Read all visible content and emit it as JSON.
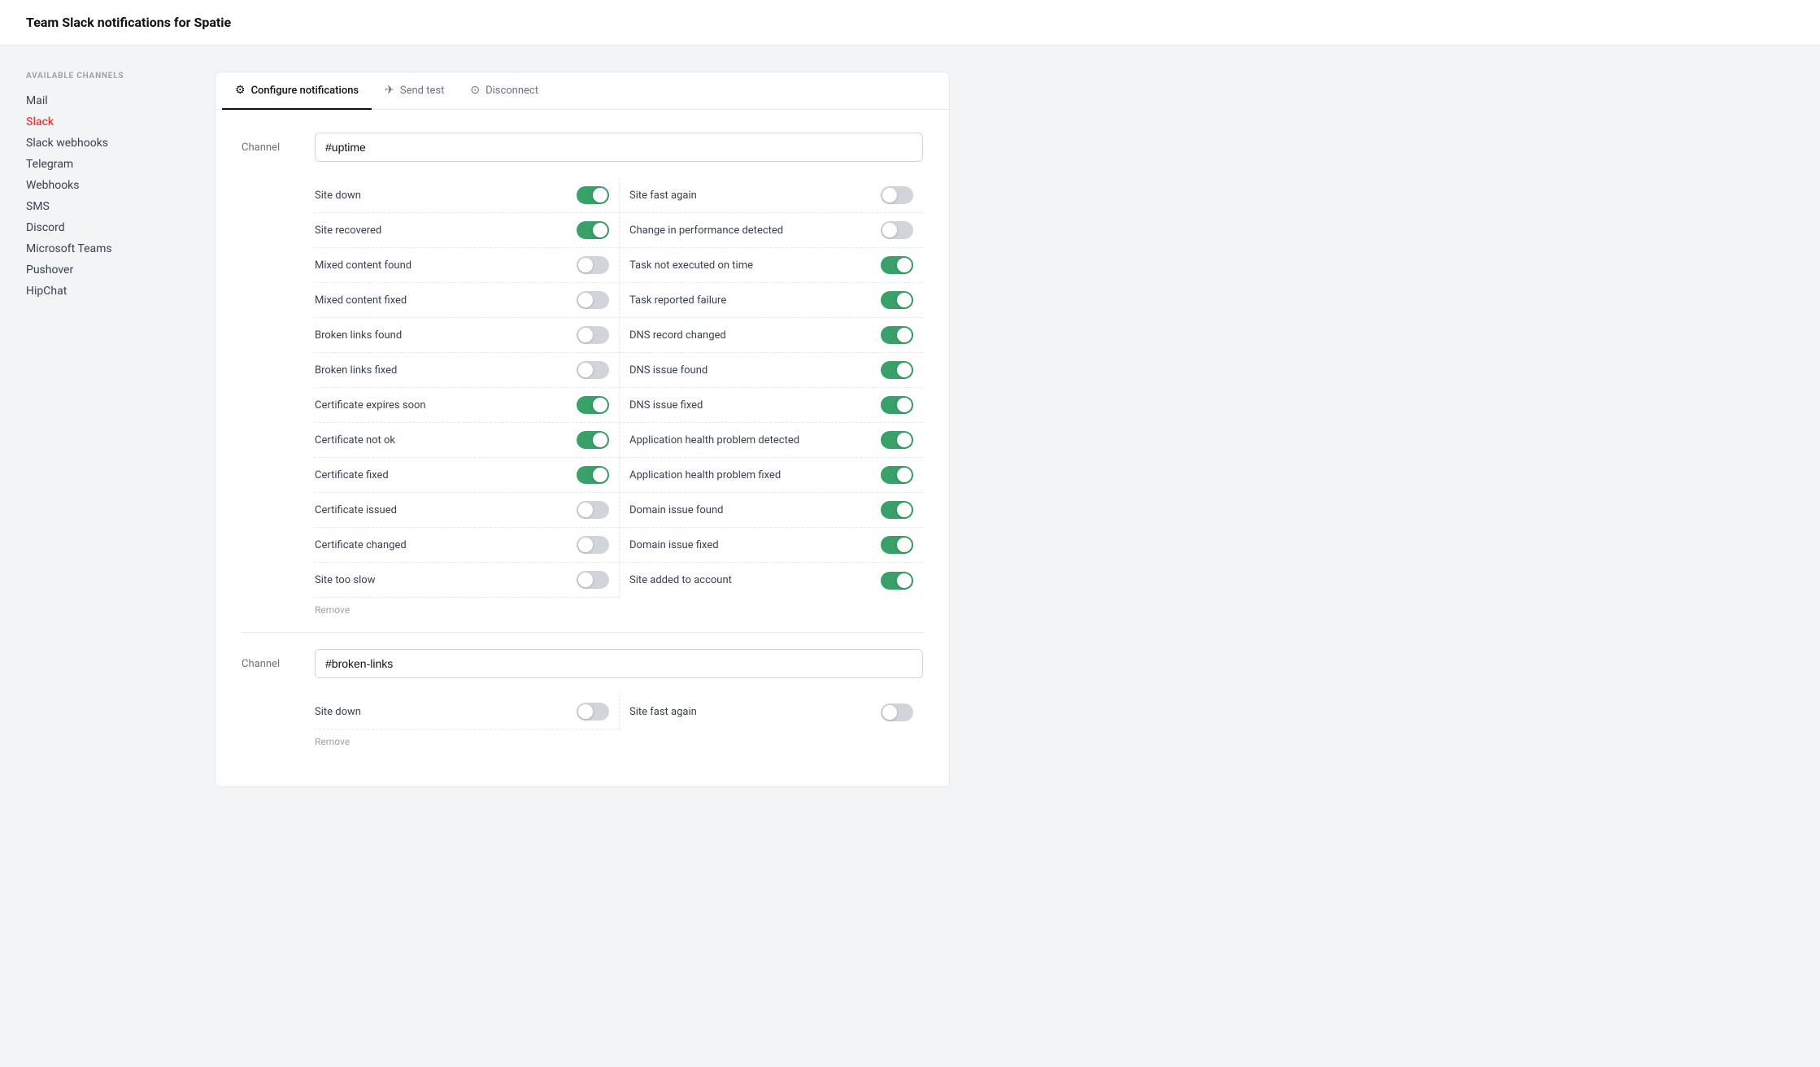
{
  "page": {
    "title": "Team Slack notifications for Spatie"
  },
  "sidebar": {
    "section_label": "Available Channels",
    "items": [
      {
        "id": "mail",
        "label": "Mail",
        "active": false
      },
      {
        "id": "slack",
        "label": "Slack",
        "active": true
      },
      {
        "id": "slack-webhooks",
        "label": "Slack webhooks",
        "active": false
      },
      {
        "id": "telegram",
        "label": "Telegram",
        "active": false
      },
      {
        "id": "webhooks",
        "label": "Webhooks",
        "active": false
      },
      {
        "id": "sms",
        "label": "SMS",
        "active": false
      },
      {
        "id": "discord",
        "label": "Discord",
        "active": false
      },
      {
        "id": "microsoft-teams",
        "label": "Microsoft Teams",
        "active": false
      },
      {
        "id": "pushover",
        "label": "Pushover",
        "active": false
      },
      {
        "id": "hipchat",
        "label": "HipChat",
        "active": false
      }
    ]
  },
  "tabs": [
    {
      "id": "configure",
      "label": "Configure notifications",
      "icon": "⚙",
      "active": true
    },
    {
      "id": "send-test",
      "label": "Send test",
      "icon": "✈",
      "active": false
    },
    {
      "id": "disconnect",
      "label": "Disconnect",
      "icon": "⊙",
      "active": false
    }
  ],
  "channels": [
    {
      "id": "uptime",
      "value": "#uptime",
      "placeholder": "#uptime",
      "remove_label": "Remove",
      "toggles": [
        {
          "id": "site-down",
          "label": "Site down",
          "on": true
        },
        {
          "id": "site-fast-again",
          "label": "Site fast again",
          "on": false
        },
        {
          "id": "site-recovered",
          "label": "Site recovered",
          "on": true
        },
        {
          "id": "change-in-performance",
          "label": "Change in performance detected",
          "on": false
        },
        {
          "id": "mixed-content-found",
          "label": "Mixed content found",
          "on": false
        },
        {
          "id": "task-not-executed",
          "label": "Task not executed on time",
          "on": true
        },
        {
          "id": "mixed-content-fixed",
          "label": "Mixed content fixed",
          "on": false
        },
        {
          "id": "task-reported-failure",
          "label": "Task reported failure",
          "on": true
        },
        {
          "id": "broken-links-found",
          "label": "Broken links found",
          "on": false
        },
        {
          "id": "dns-record-changed",
          "label": "DNS record changed",
          "on": true
        },
        {
          "id": "broken-links-fixed",
          "label": "Broken links fixed",
          "on": false
        },
        {
          "id": "dns-issue-found",
          "label": "DNS issue found",
          "on": true
        },
        {
          "id": "certificate-expires-soon",
          "label": "Certificate expires soon",
          "on": true
        },
        {
          "id": "dns-issue-fixed",
          "label": "DNS issue fixed",
          "on": true
        },
        {
          "id": "certificate-not-ok",
          "label": "Certificate not ok",
          "on": true
        },
        {
          "id": "app-health-problem-detected",
          "label": "Application health problem detected",
          "on": true
        },
        {
          "id": "certificate-fixed",
          "label": "Certificate fixed",
          "on": true
        },
        {
          "id": "app-health-problem-fixed",
          "label": "Application health problem fixed",
          "on": true
        },
        {
          "id": "certificate-issued",
          "label": "Certificate issued",
          "on": false
        },
        {
          "id": "domain-issue-found",
          "label": "Domain issue found",
          "on": true
        },
        {
          "id": "certificate-changed",
          "label": "Certificate changed",
          "on": false
        },
        {
          "id": "domain-issue-fixed",
          "label": "Domain issue fixed",
          "on": true
        },
        {
          "id": "site-too-slow",
          "label": "Site too slow",
          "on": false
        },
        {
          "id": "site-added-to-account",
          "label": "Site added to account",
          "on": true
        }
      ]
    },
    {
      "id": "broken-links",
      "value": "#broken-links",
      "placeholder": "#broken-links",
      "remove_label": "Remove",
      "toggles": [
        {
          "id": "site-down-2",
          "label": "Site down",
          "on": false
        },
        {
          "id": "site-fast-again-2",
          "label": "Site fast again",
          "on": false
        }
      ]
    }
  ]
}
